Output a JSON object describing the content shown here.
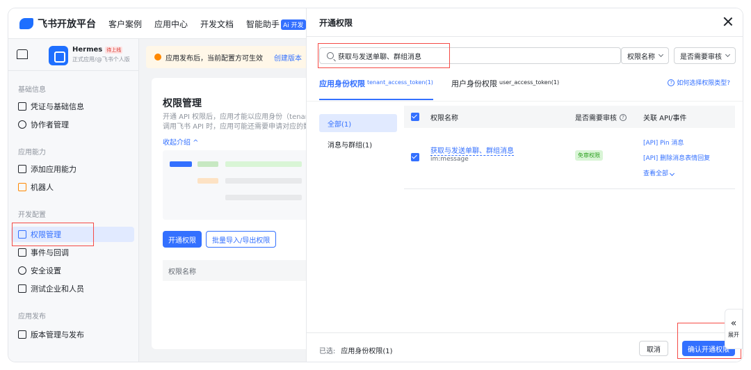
{
  "topbar": {
    "logo_text": "飞书开放平台",
    "nav": [
      "客户案例",
      "应用中心",
      "开发文档",
      "智能助手"
    ],
    "ai_badge": "Ai 开发"
  },
  "app": {
    "name": "Hermes",
    "status_tag": "待上线",
    "subtitle": "正式应用/@飞书个人版"
  },
  "sidebar": {
    "groups": {
      "basic": "基础信息",
      "capability": "应用能力",
      "dev_config": "开发配置",
      "release": "应用发布"
    },
    "items": {
      "credentials": "凭证与基础信息",
      "collaborators": "协作者管理",
      "add_capability": "添加应用能力",
      "bot": "机器人",
      "permissions": "权限管理",
      "events": "事件与回调",
      "security": "安全设置",
      "test_enterprise": "测试企业和人员",
      "version": "版本管理与发布"
    }
  },
  "notice": {
    "text": "应用发布后，当前配置方可生效",
    "link": "创建版本"
  },
  "bg_main": {
    "title": "权限管理",
    "desc_line1": "开通 API 权限后，应用才能以应用身份（tenant",
    "desc_line2": "调用飞书 API 时，应用可能还需要申请对应的数",
    "fold": "收起介绍 ^",
    "btn_open": "开通权限",
    "btn_batch": "批量导入/导出权限",
    "table_col": "权限名称"
  },
  "drawer": {
    "title": "开通权限",
    "search_value": "获取与发送单聊、群组消息",
    "dd_name": "权限名称",
    "dd_review": "是否需要审核",
    "tab_app": "应用身份权限",
    "tab_app_token": "tenant_access_token(1)",
    "tab_user": "用户身份权限",
    "tab_user_token": "user_access_token(1)",
    "help": "如何选择权限类型?",
    "categories": [
      "全部(1)",
      "消息与群组(1)"
    ],
    "table": {
      "col_name": "权限名称",
      "col_review": "是否需要审核",
      "col_api": "关联 API/事件"
    },
    "row": {
      "name": "获取与发送单聊、群组消息",
      "key": "im:message",
      "review_tag": "免审权限",
      "apis": [
        "[API] Pin 消息",
        "[API] 删除消息表情回复"
      ],
      "view_all": "查看全部"
    },
    "selected_label": "已选:",
    "selected_value": "应用身份权限(1)",
    "cancel": "取消",
    "confirm": "确认开通权限",
    "expand": "展开"
  }
}
